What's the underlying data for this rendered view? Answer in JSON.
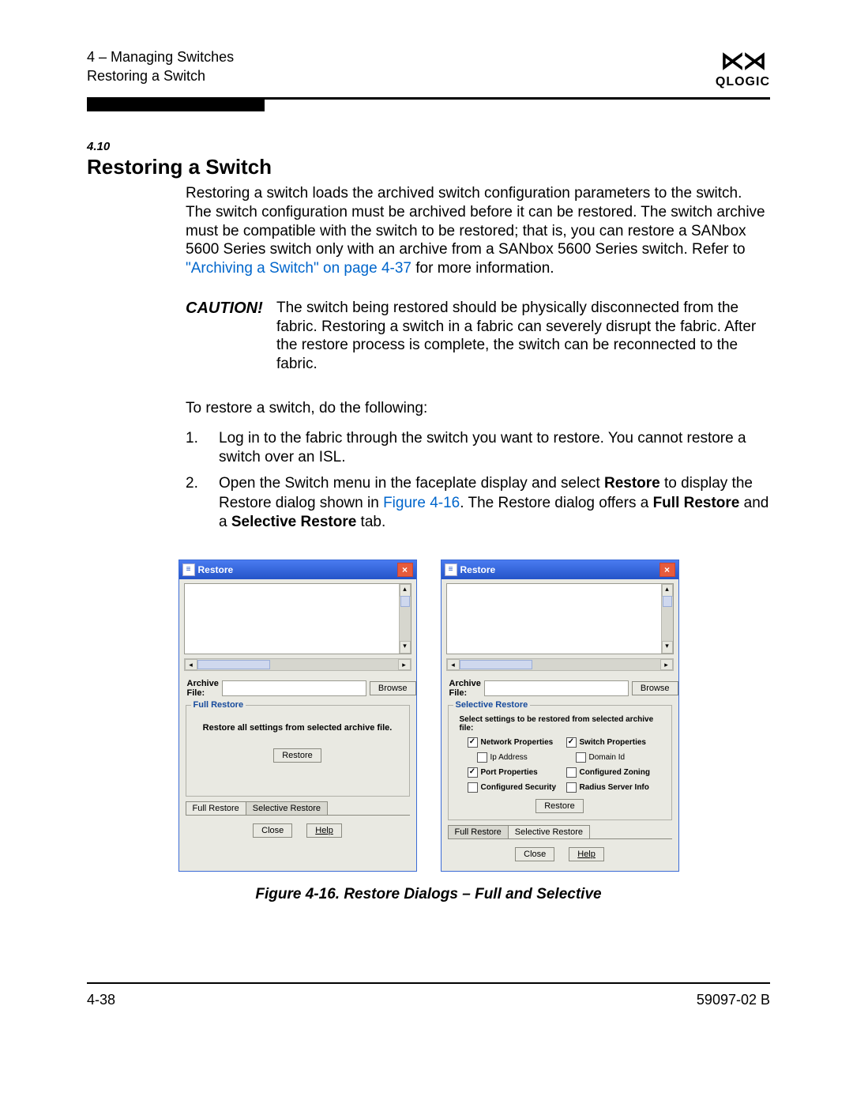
{
  "header": {
    "chapter_line": "4 – Managing Switches",
    "section_line": "Restoring a Switch",
    "brand": "QLOGIC"
  },
  "section": {
    "number": "4.10",
    "title": "Restoring a Switch"
  },
  "intro": {
    "part1": "Restoring a switch loads the archived switch configuration parameters to the switch. The switch configuration must be archived before it can be restored. The switch archive must be compatible with the switch to be restored; that is, you can restore a SANbox 5600 Series switch only with an archive from a SANbox 5600 Series switch. Refer to ",
    "link": "\"Archiving a Switch\" on page 4-37",
    "part2": " for more information."
  },
  "caution": {
    "label": "CAUTION!",
    "text": "The switch being restored should be physically disconnected from the fabric. Restoring a switch in a fabric can severely disrupt the fabric. After the restore process is complete, the switch can be reconnected to the fabric."
  },
  "lead_in": "To restore a switch, do the following:",
  "steps": {
    "s1": "Log in to the fabric through the switch you want to restore. You cannot restore a switch over an ISL.",
    "s2_a": "Open the Switch menu in the faceplate display and select ",
    "s2_b": "Restore",
    "s2_c": " to display the Restore dialog shown in ",
    "s2_link": "Figure 4-16",
    "s2_d": ". The Restore dialog offers a ",
    "s2_e": "Full Restore",
    "s2_f": " and a ",
    "s2_g": "Selective Restore",
    "s2_h": " tab."
  },
  "dialog": {
    "title": "Restore",
    "archive_label": "Archive File:",
    "browse": "Browse",
    "full_group": "Full Restore",
    "full_text": "Restore all settings from selected archive file.",
    "sel_group": "Selective Restore",
    "sel_text": "Select settings to be restored from selected archive file:",
    "restore_btn": "Restore",
    "tab_full": "Full Restore",
    "tab_sel": "Selective Restore",
    "close": "Close",
    "help": "Help",
    "opts": {
      "net": "Network Properties",
      "ip": "Ip Address",
      "port": "Port Properties",
      "sec": "Configured Security",
      "switch": "Switch Properties",
      "domain": "Domain Id",
      "zoning": "Configured Zoning",
      "radius": "Radius Server Info"
    }
  },
  "figure_caption": "Figure 4-16.  Restore Dialogs – Full and Selective",
  "footer": {
    "left": "4-38",
    "right": "59097-02 B"
  }
}
